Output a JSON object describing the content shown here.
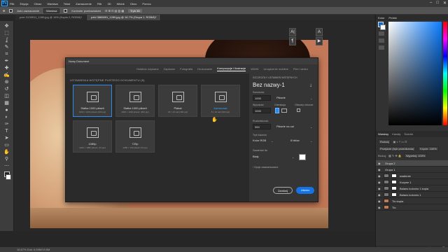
{
  "menubar": {
    "logo": "Ps",
    "items": [
      "Plik",
      "Edycja",
      "Obraz",
      "Warstwa",
      "Tekst",
      "Zaznaczenie",
      "Filtr",
      "3D",
      "Widok",
      "Okno",
      "Pomoc"
    ],
    "controls": [
      "–",
      "□",
      "✕"
    ]
  },
  "options": {
    "auto_select_label": "Auto zaznaczanie",
    "auto_select_value": "Warstwa",
    "transform_label": "Kontroler przekształceń",
    "mode_label": "Tryb 3D"
  },
  "tabs": [
    {
      "label": "pxer 3139911_1280.jpg @ 16% (Kopia 2, RGB/8)*",
      "active": false
    },
    {
      "label": "pxbl 3865891_1280.jpg @ 16.7% (Grupa 1, RGB/8)*",
      "active": true
    }
  ],
  "toolbar": {
    "tools": [
      "move-icon",
      "marquee-icon",
      "lasso-icon",
      "quick-select-icon",
      "crop-icon",
      "eyedropper-icon",
      "healing-icon",
      "brush-icon",
      "stamp-icon",
      "history-brush-icon",
      "eraser-icon",
      "gradient-icon",
      "blur-icon",
      "dodge-icon",
      "pen-icon",
      "type-icon",
      "path-select-icon",
      "rectangle-icon",
      "hand-icon",
      "zoom-icon",
      "dots-icon"
    ],
    "glyphs": [
      "✥",
      "⬚",
      "ʆ",
      "✎",
      "⌗",
      "✒",
      "✚",
      "✍",
      "⊛",
      "↺",
      "◫",
      "▦",
      "●",
      "◐",
      "✑",
      "T",
      "➤",
      "▭",
      "✋",
      "⚲",
      "⋯"
    ]
  },
  "status": {
    "text": "16,67%   Dok: 6,59M/19,9M"
  },
  "float_icons": [
    "A|",
    "¶",
    "A",
    "▶"
  ],
  "dialog": {
    "title": "Nowy Dokument",
    "tabs": [
      {
        "label": "Ostatnio używane",
        "active": false
      },
      {
        "label": "Zapisane",
        "active": false
      },
      {
        "label": "Fotografia",
        "active": false
      },
      {
        "label": "Drukowanie",
        "active": false
      },
      {
        "label": "Kompozycje i Ilustracje",
        "active": true
      },
      {
        "label": "WWW",
        "active": false
      },
      {
        "label": "Urządzenie mobilne",
        "active": false
      },
      {
        "label": "Film i wideo",
        "active": false
      }
    ],
    "presets_header": "USTAWIENIA WSTĘPNE PUSTEGO DOKUMENTU (6)",
    "cards": [
      {
        "name": "Siatka 1000 pikseli",
        "size": "1000 × 1000 pikseli (300 ppi)",
        "selected": true,
        "blue": false
      },
      {
        "name": "Siatka 1000 pikseli",
        "size": "1000 × 1000 pikseli, (300 ppi)",
        "selected": false,
        "blue": false
      },
      {
        "name": "Plakat",
        "size": "18 × 24 cali (300 ppi)",
        "selected": false,
        "blue": false
      },
      {
        "name": "Kartonowe",
        "size": "8 × 10 cali (300 ppi)",
        "selected": false,
        "blue": true
      },
      {
        "name": "1080p",
        "size": "1920 × 1080 pikseli, (72 ppi)",
        "selected": false,
        "blue": false
      },
      {
        "name": "720p",
        "size": "1280 × 720 pikseli (72 ppi)",
        "selected": false,
        "blue": false
      }
    ],
    "details": {
      "header": "SZCZEGÓŁY USTAWIEŃ WSTĘPNYCH",
      "doc_name": "Bez nazwy-1",
      "width_label": "Szerokość",
      "width_value": "1000",
      "width_unit": "Piksele",
      "height_label": "Wysokość",
      "height_value": "1000",
      "orientation_label": "Orientacja",
      "artboards_label": "Obszary robocze",
      "resolution_label": "Rozdzielczość",
      "resolution_value": "300",
      "resolution_unit": "Piksele na cal",
      "color_mode_label": "Tryb kolorów",
      "color_mode_value": "Kolor RGB",
      "bit_depth_value": "8 bitów",
      "background_label": "Zawartość tła",
      "background_value": "Biały",
      "advanced_label": "Opcje zaawansowane"
    },
    "close_label": "Zamknij",
    "create_label": "Utwórz"
  },
  "right_dock": {
    "color_tabs": [
      "Kolor",
      "Próbki"
    ],
    "layers_tabs": [
      {
        "label": "Warstwy",
        "active": true
      },
      {
        "label": "Kanały",
        "active": false
      },
      {
        "label": "Ścieżki",
        "active": false
      }
    ],
    "kind_label": "Rodzaj",
    "blend_mode": "Przejście (tryb przenikania)",
    "opacity_label": "Krycie: 100%",
    "lock_label": "Blokuj:",
    "fill_label": "Wypełnij: 100%",
    "layers": [
      {
        "name": "Grupa 2",
        "selected": true
      },
      {
        "name": "Grupa 1",
        "selected": false
      },
      {
        "name": "nasilenie",
        "selected": false
      },
      {
        "name": "Krzywe 1",
        "selected": false
      },
      {
        "name": "Balans kolorów 1 kopia",
        "selected": false
      },
      {
        "name": "Balans kolorów 1",
        "selected": false
      },
      {
        "name": "Tło kopia",
        "selected": false
      },
      {
        "name": "Tło",
        "selected": false
      }
    ],
    "footer_icons": [
      "fx",
      "◐",
      "▭",
      "🗀",
      "⊞",
      "🗑"
    ]
  }
}
